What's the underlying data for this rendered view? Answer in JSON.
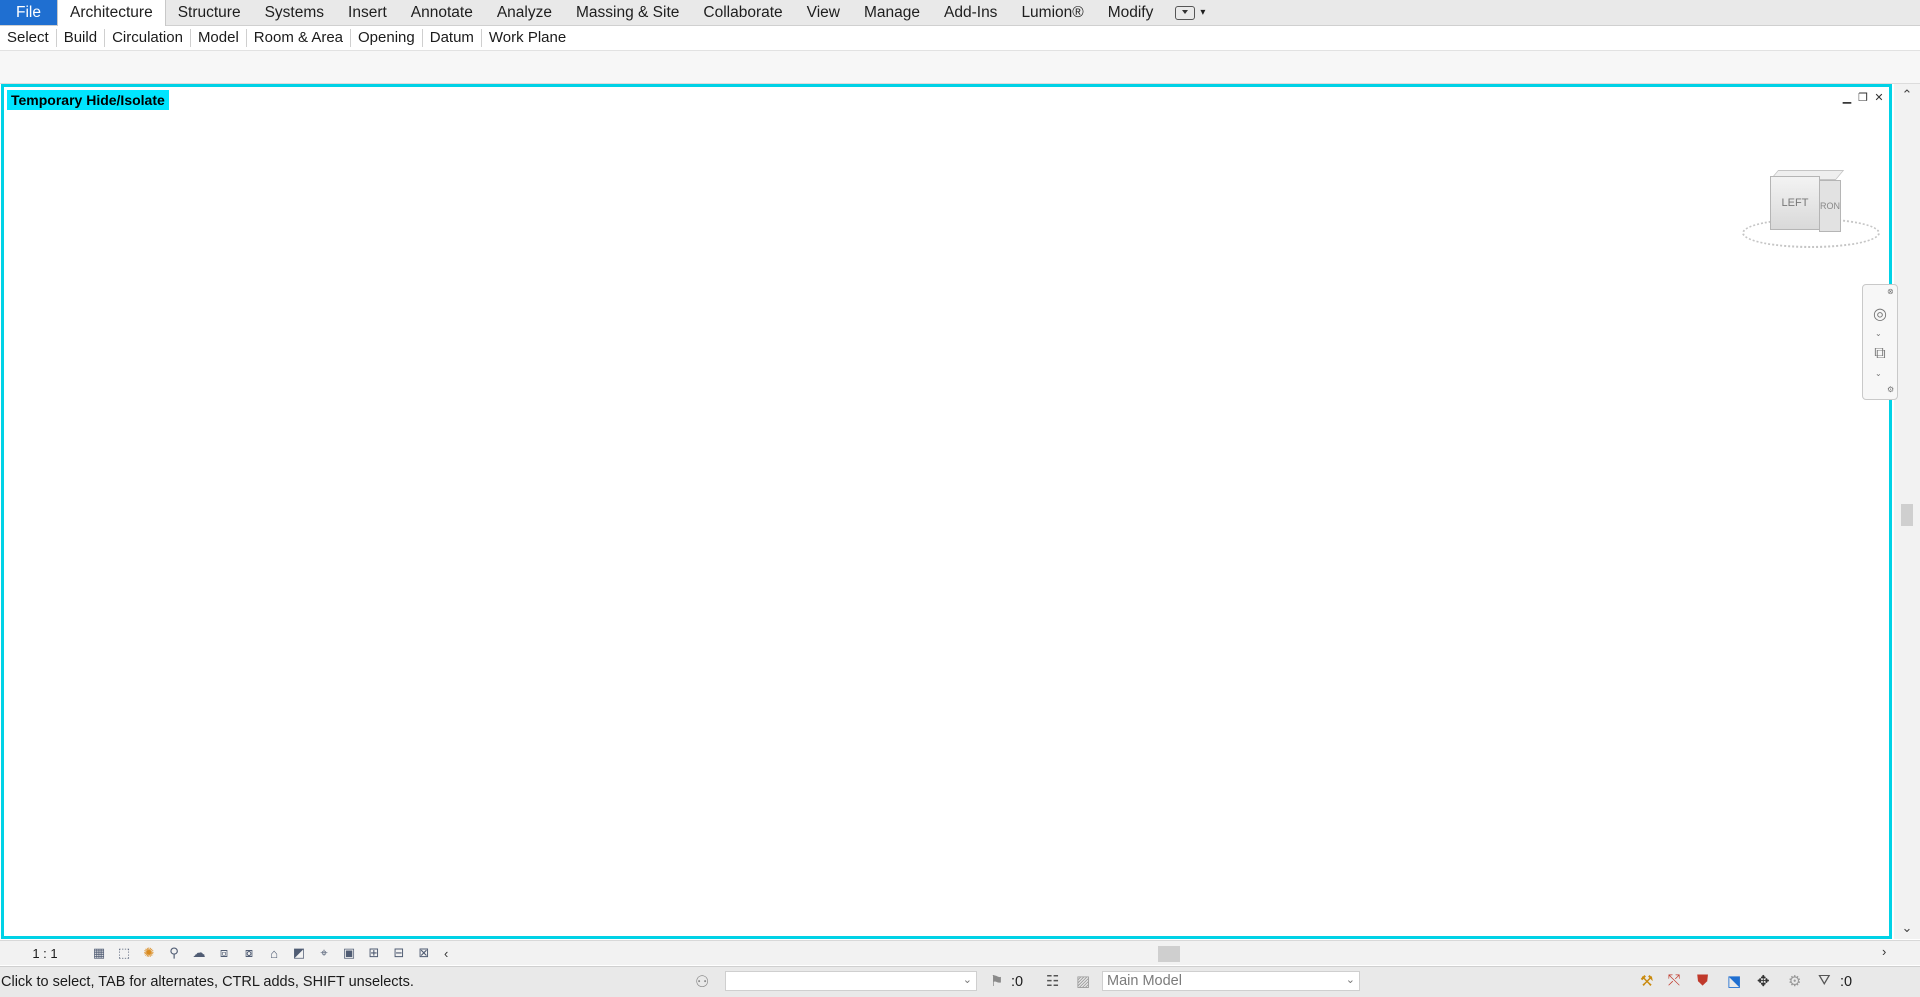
{
  "ribbon": {
    "tabs": [
      "File",
      "Architecture",
      "Structure",
      "Systems",
      "Insert",
      "Annotate",
      "Analyze",
      "Massing & Site",
      "Collaborate",
      "View",
      "Manage",
      "Add-Ins",
      "Lumion®",
      "Modify"
    ],
    "active_tab": "Architecture"
  },
  "panels": [
    "Select",
    "Build",
    "Circulation",
    "Model",
    "Room & Area",
    "Opening",
    "Datum",
    "Work Plane"
  ],
  "view": {
    "mode_badge": "Temporary Hide/Isolate",
    "viewcube": {
      "front": "LEFT",
      "right": "FRONT"
    },
    "highlight_color": "#00d2e6",
    "element_color": "#7ddb2a",
    "shadow_color": "#808080"
  },
  "view_control_bar": {
    "scale": "1 : 1",
    "icons": [
      "detail-level-icon",
      "visual-style-icon",
      "sun-path-icon",
      "shadows-icon",
      "render-icon",
      "crop-view-icon",
      "show-crop-icon",
      "lock-3d-icon",
      "temporary-hide-icon",
      "reveal-hidden-icon",
      "temporary-view-properties-icon",
      "analysis-icon",
      "highlight-displacement-icon",
      "worksharing-display-icon",
      "reveal-constraints-icon"
    ]
  },
  "status_bar": {
    "message": "Click to select, TAB for alternates, CTRL adds, SHIFT unselects.",
    "workset_value": "",
    "editable_count": ":0",
    "design_option": "Main Model",
    "filter_count": ":0"
  }
}
